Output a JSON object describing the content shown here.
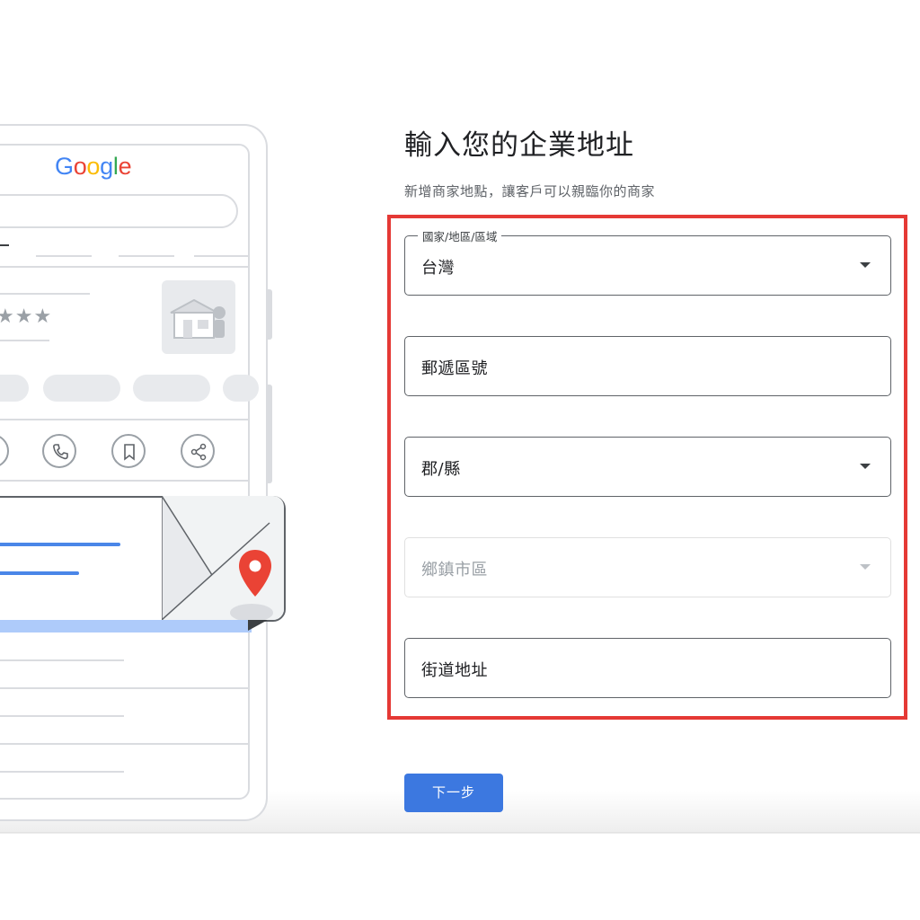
{
  "illustration": {
    "logo_letters": [
      "G",
      "o",
      "o",
      "g",
      "l",
      "e"
    ],
    "rating_stars": "★★★",
    "action_icons": [
      "directions-icon",
      "phone-icon",
      "bookmark-icon",
      "share-icon"
    ]
  },
  "form": {
    "title": "輸入您的企業地址",
    "subtitle": "新增商家地點，讓客戶可以親臨你的商家",
    "fields": [
      {
        "label": "國家/地區/區域",
        "value": "台灣",
        "type": "select"
      },
      {
        "label": "",
        "value": "郵遞區號",
        "type": "text"
      },
      {
        "label": "",
        "value": "郡/縣",
        "type": "select"
      },
      {
        "label": "",
        "value": "鄉鎮市區",
        "type": "select",
        "disabled": true
      },
      {
        "label": "",
        "value": "街道地址",
        "type": "text"
      }
    ],
    "next_button": "下一步"
  },
  "colors": {
    "highlight": "#e53935",
    "primary_button": "#3c78e0",
    "map_pin": "#ea4335"
  }
}
